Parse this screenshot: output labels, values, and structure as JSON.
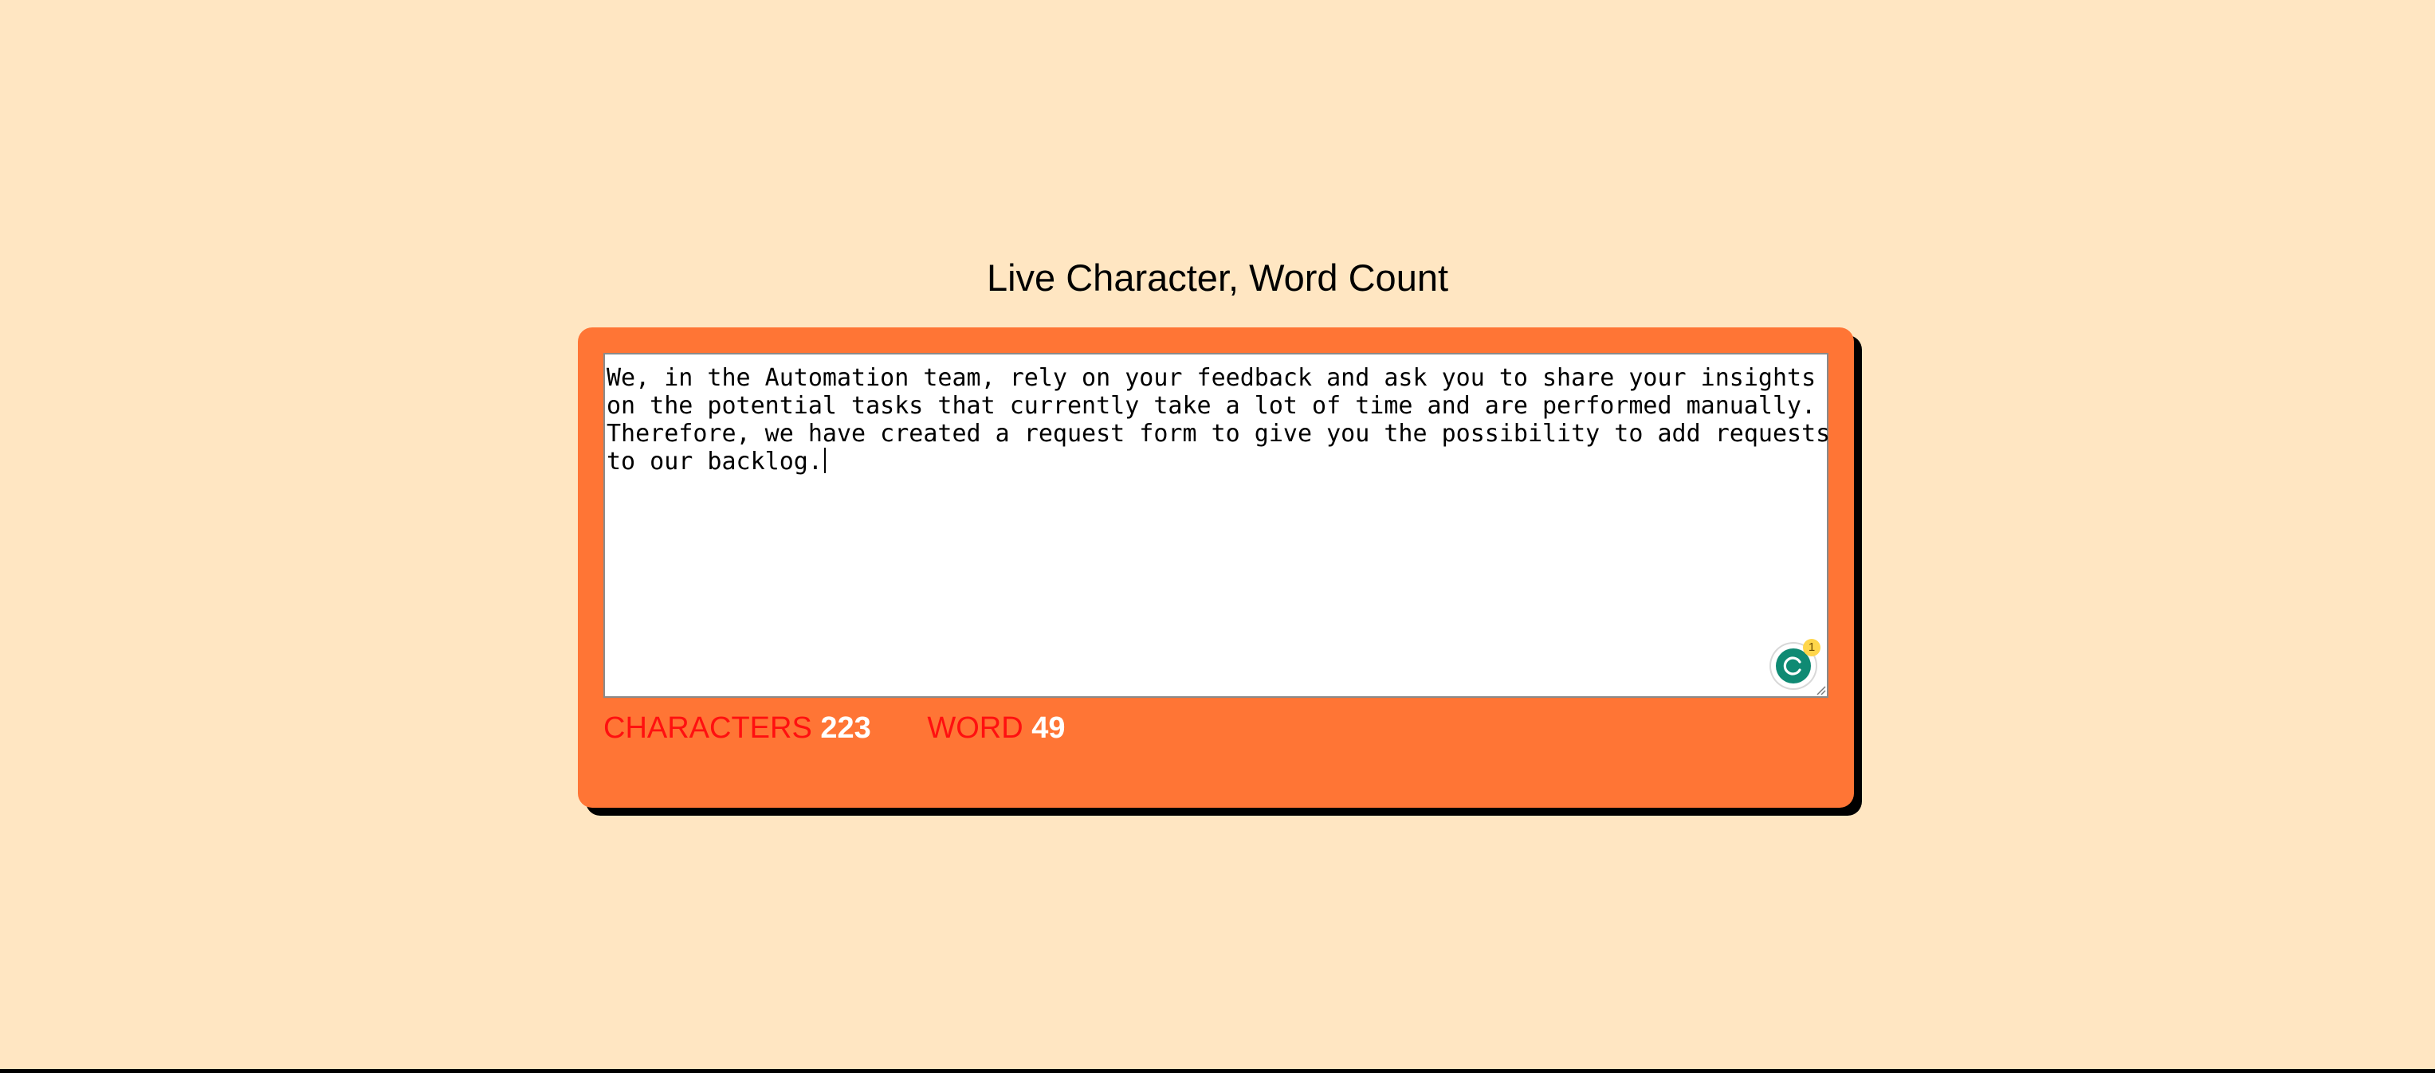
{
  "header": {
    "title": "Live Character, Word Count"
  },
  "editor": {
    "lines": [
      "We, in the Automation team, rely on your feedback and ask you to share your insights",
      "on the potential tasks that currently take a lot of time and are performed manually.",
      "Therefore, we have created a request form to give you the possibility to add requests",
      "to our backlog."
    ],
    "assistant_badge_count": "1"
  },
  "stats": {
    "characters_label": "CHARACTERS",
    "characters_value": "223",
    "word_label": "WORD",
    "word_value": "49"
  },
  "colors": {
    "background": "#ffe6c2",
    "card": "#ff7535",
    "label": "#ff1010",
    "value": "#ffffff",
    "assistant_icon": "#0f8a73"
  }
}
